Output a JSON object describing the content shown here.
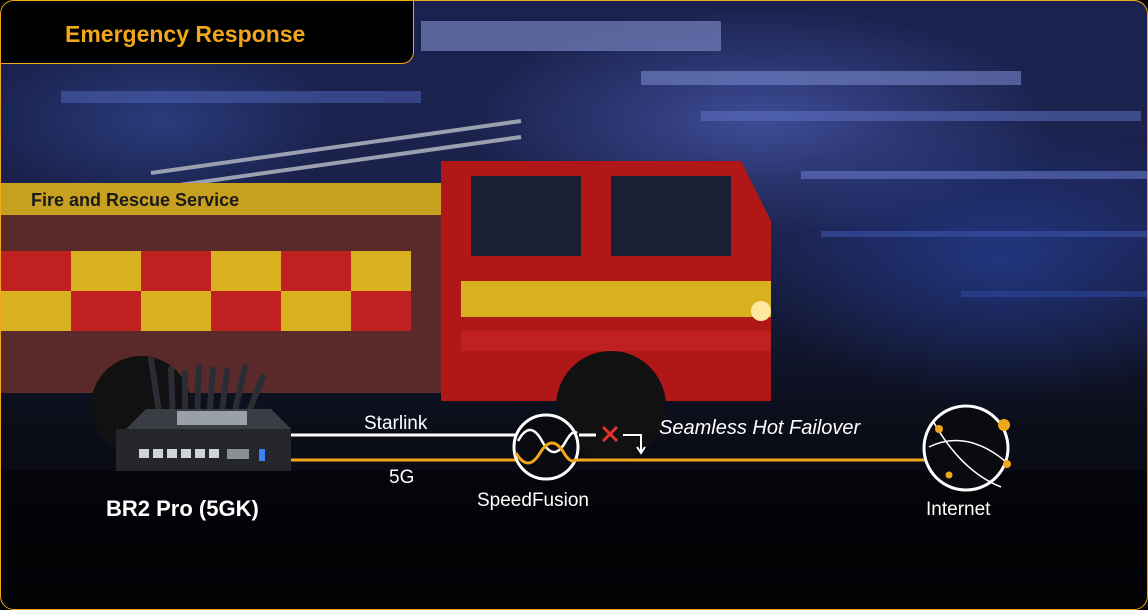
{
  "header": {
    "title": "Emergency Response"
  },
  "truck": {
    "side_text": "Fire and Rescue Service"
  },
  "diagram": {
    "device_label": "BR2 Pro (5GK)",
    "link_starlink": "Starlink",
    "link_5g": "5G",
    "hub_label": "SpeedFusion",
    "failover_label": "Seamless Hot Failover",
    "destination_label": "Internet"
  },
  "colors": {
    "accent": "#f2a71b",
    "link_white": "#ffffff",
    "fail_red": "#e5322d"
  },
  "icons": [
    "router-device-icon",
    "speedfusion-wave-icon",
    "failure-x-icon",
    "internet-globe-icon"
  ]
}
